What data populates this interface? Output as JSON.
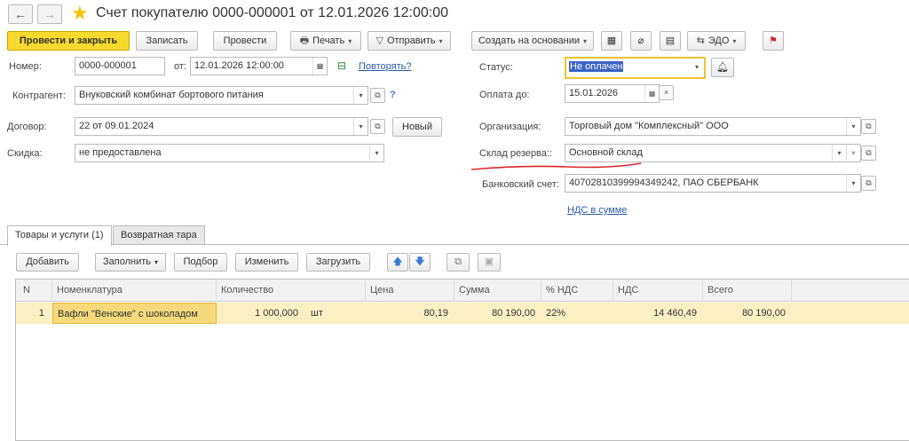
{
  "header": {
    "back_icon": "arrow-left-icon",
    "forward_icon": "arrow-right-icon",
    "back_glyph": "←",
    "forward_glyph": "→",
    "favorite_icon": "star-icon",
    "star_glyph": "★",
    "title": "Счет покупателю 0000-000001 от 12.01.2026 12:00:00"
  },
  "toolbar": {
    "post_close": "Провести и закрыть",
    "save": "Записать",
    "post": "Провести",
    "print": "Печать",
    "send": "Отправить",
    "create_based": "Создать на основании",
    "edo": "ЭДО",
    "dropdown_glyph": "▾"
  },
  "form": {
    "number_label": "Номер:",
    "number_value": "0000-000001",
    "date_label": "от:",
    "date_value": "12.01.2026 12:00:00",
    "repeat_link": "Повторять?",
    "counterparty_label": "Контрагент:",
    "counterparty_value": "Внуковский комбинат бортового питания",
    "contract_label": "Договор:",
    "contract_value": "22 от 09.01.2024",
    "new_button": "Новый",
    "discount_label": "Скидка:",
    "discount_value": "не предоставлена",
    "status_label": "Статус:",
    "status_value": "Не оплачен",
    "pay_until_label": "Оплата до:",
    "pay_until_value": "15.01.2026",
    "organization_label": "Организация:",
    "organization_value": "Торговый дом \"Комплексный\" ООО",
    "warehouse_label": "Склад резерва::",
    "warehouse_value": "Основной склад",
    "bank_label": "Банковский счет:",
    "bank_value": "40702810399994349242, ПАО СБЕРБАНК",
    "vat_link": "НДС в сумме",
    "help_glyph": "?"
  },
  "tabs": [
    {
      "label": "Товары и услуги (1)"
    },
    {
      "label": "Возвратная тара"
    }
  ],
  "table_toolbar": {
    "add": "Добавить",
    "fill": "Заполнить",
    "pick": "Подбор",
    "change": "Изменить",
    "load": "Загрузить"
  },
  "table": {
    "columns": [
      "N",
      "Номенклатура",
      "Количество",
      "Цена",
      "Сумма",
      "% НДС",
      "НДС",
      "Всего"
    ],
    "rows": [
      {
        "n": "1",
        "item": "Вафли \"Венские\" с шоколадом",
        "qty": "1 000,000",
        "unit": "шт",
        "price": "80,19",
        "sum": "80 190,00",
        "vat_rate": "22%",
        "vat": "14 460,49",
        "total": "80 190,00"
      }
    ]
  },
  "colors": {
    "primary_button": "#f8d92e",
    "selected_row": "#fbf0c2",
    "link": "#2a5ba8",
    "annotation_underline": "#d9262c",
    "status_highlight": "#3b63c4"
  }
}
